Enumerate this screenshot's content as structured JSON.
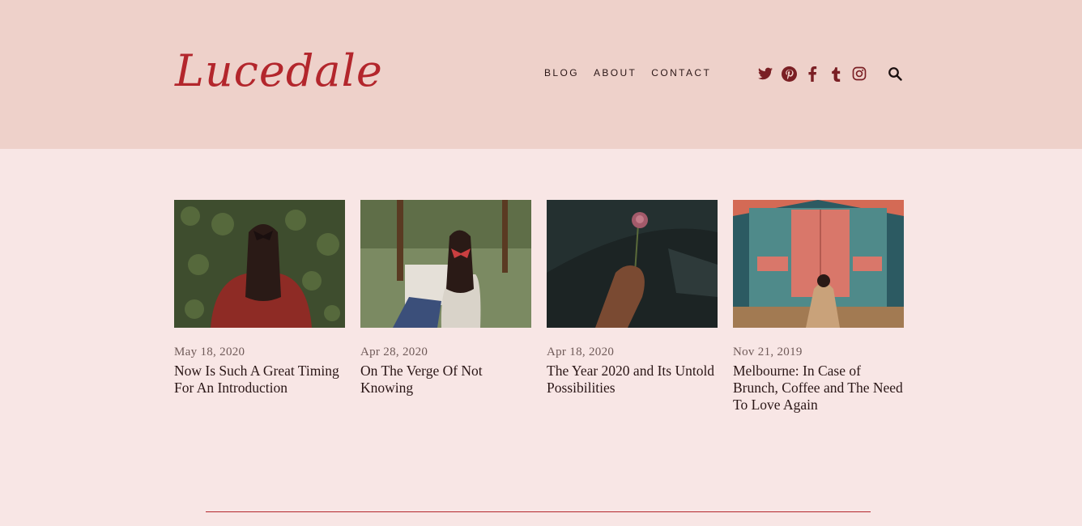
{
  "brand": {
    "logo": "Lucedale",
    "accent": "#b3262c"
  },
  "nav": {
    "items": [
      "BLOG",
      "ABOUT",
      "CONTACT"
    ]
  },
  "social": {
    "icons": [
      "twitter-icon",
      "pinterest-icon",
      "facebook-icon",
      "tumblr-icon",
      "instagram-icon"
    ],
    "color": "#7a1f24"
  },
  "search": {
    "icon": "search-icon"
  },
  "posts": [
    {
      "date": "May 18, 2020",
      "title": "Now Is Such A Great Timing For An Introduction"
    },
    {
      "date": "Apr 28, 2020",
      "title": "On The Verge Of Not Knowing"
    },
    {
      "date": "Apr 18, 2020",
      "title": "The Year 2020 and Its Untold Possibilities"
    },
    {
      "date": "Nov 21, 2019",
      "title": "Melbourne: In Case of Brunch, Coffee and The Need To Love Again"
    }
  ]
}
